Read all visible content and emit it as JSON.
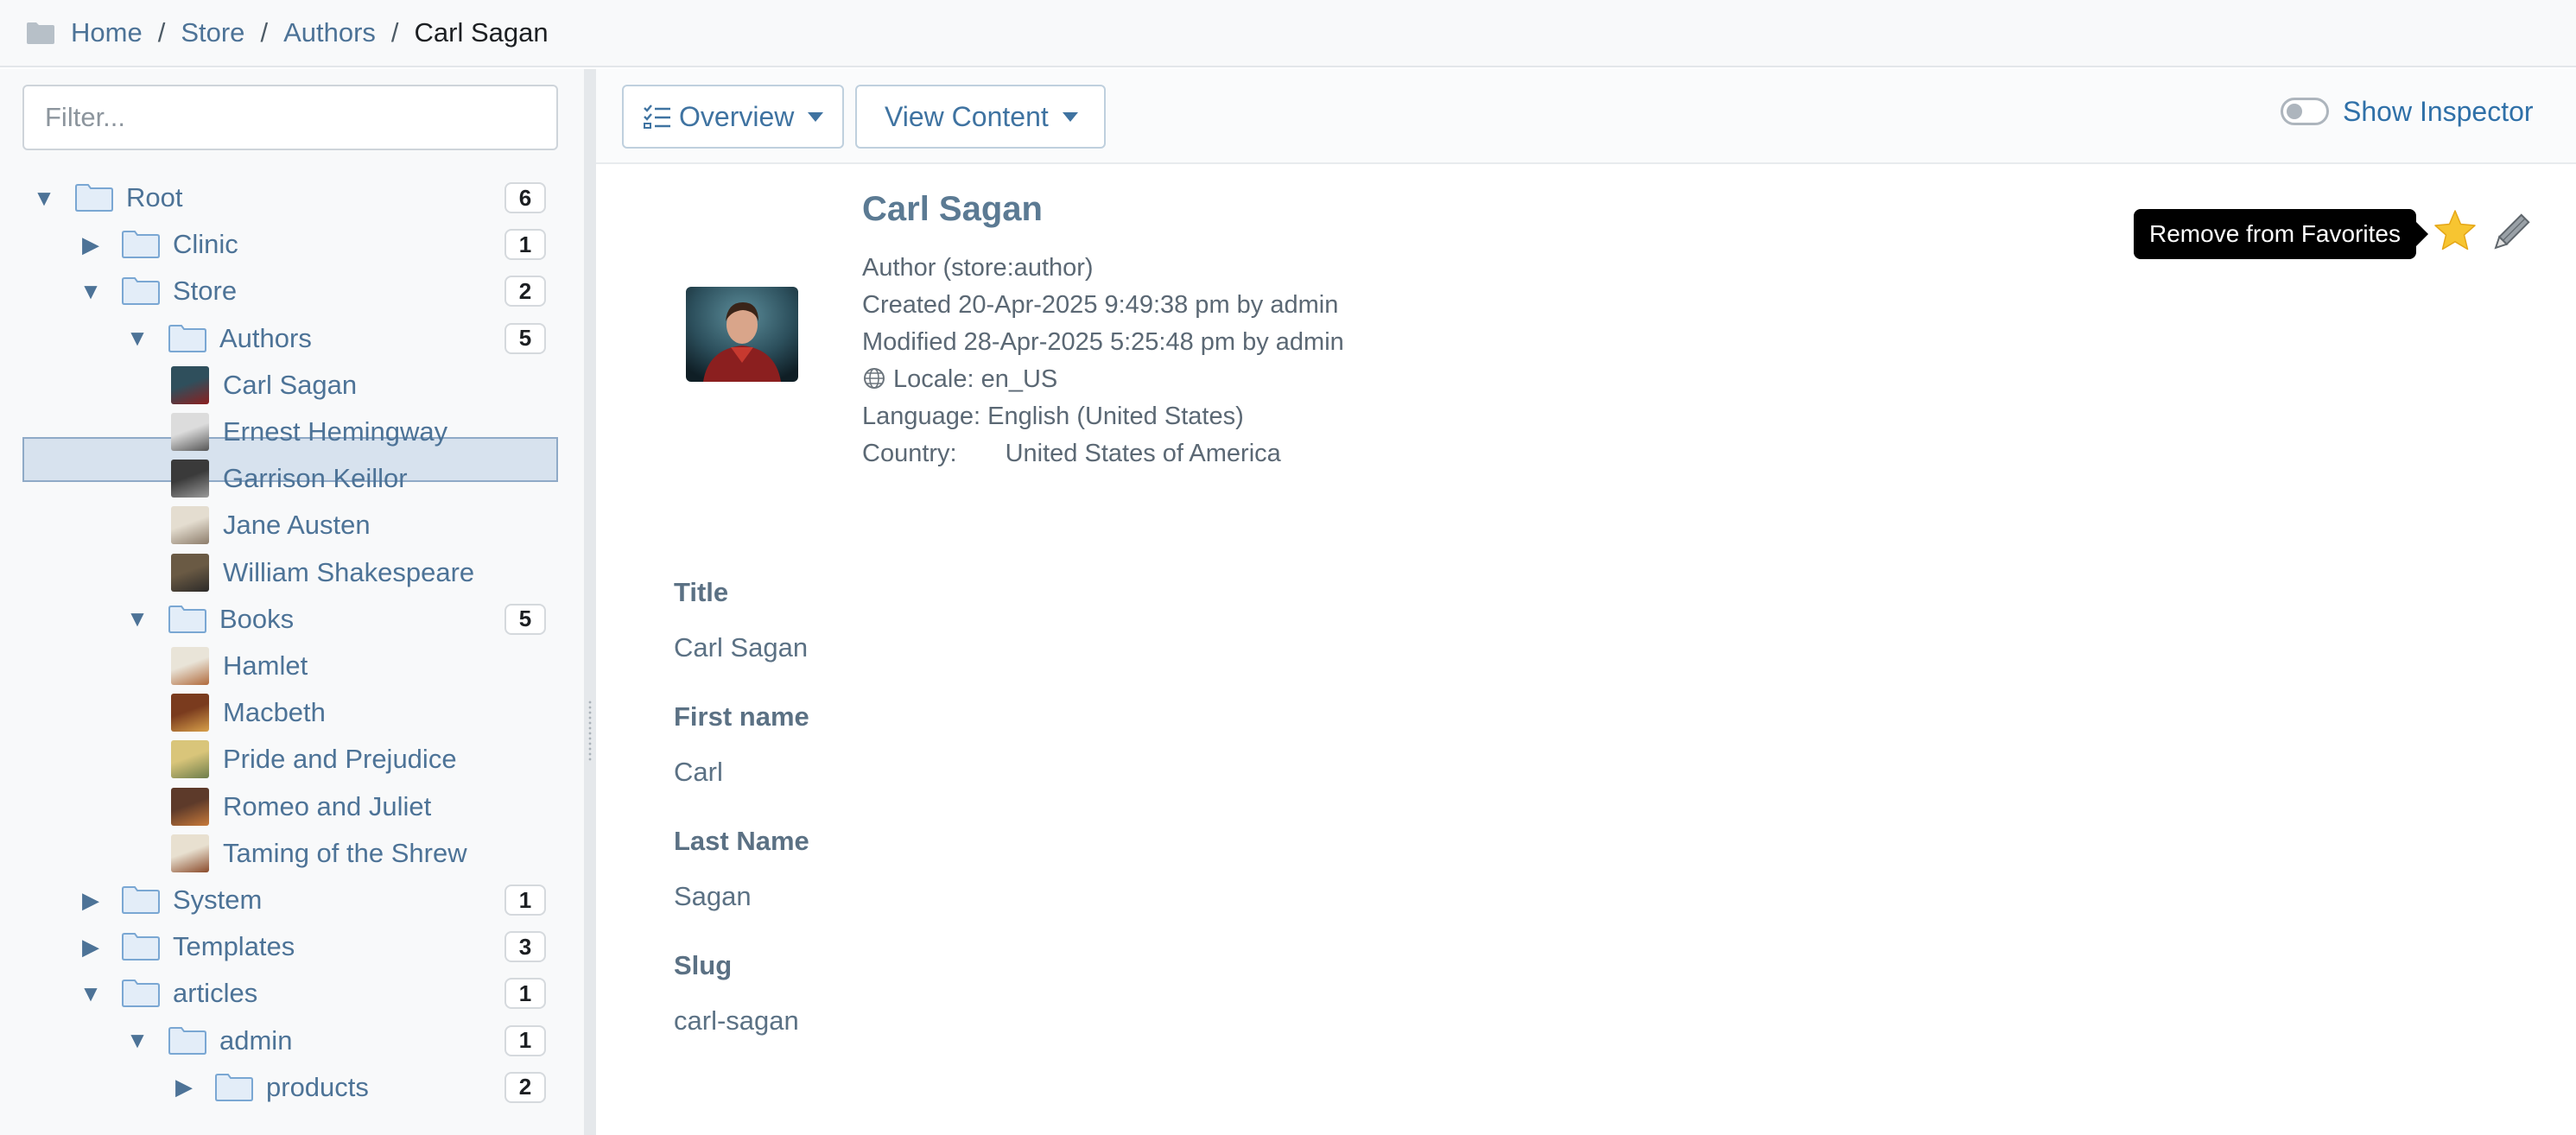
{
  "breadcrumb": {
    "items": [
      "Home",
      "Store",
      "Authors"
    ],
    "separator": "/",
    "current": "Carl Sagan"
  },
  "sidebar": {
    "filter_placeholder": "Filter...",
    "tree": [
      {
        "label": "Root",
        "count": "6",
        "expanded": true,
        "kind": "folder"
      },
      {
        "label": "Clinic",
        "count": "1",
        "expanded": false,
        "kind": "folder"
      },
      {
        "label": "Store",
        "count": "2",
        "expanded": true,
        "kind": "folder"
      },
      {
        "label": "Authors",
        "count": "5",
        "expanded": true,
        "kind": "folder"
      },
      {
        "label": "Carl Sagan",
        "kind": "item",
        "selected": true
      },
      {
        "label": "Ernest Hemingway",
        "kind": "item"
      },
      {
        "label": "Garrison Keillor",
        "kind": "item"
      },
      {
        "label": "Jane Austen",
        "kind": "item"
      },
      {
        "label": "William Shakespeare",
        "kind": "item"
      },
      {
        "label": "Books",
        "count": "5",
        "expanded": true,
        "kind": "folder"
      },
      {
        "label": "Hamlet",
        "kind": "item"
      },
      {
        "label": "Macbeth",
        "kind": "item"
      },
      {
        "label": "Pride and Prejudice",
        "kind": "item"
      },
      {
        "label": "Romeo and Juliet",
        "kind": "item"
      },
      {
        "label": "Taming of the Shrew",
        "kind": "item"
      },
      {
        "label": "System",
        "count": "1",
        "expanded": false,
        "kind": "folder"
      },
      {
        "label": "Templates",
        "count": "3",
        "expanded": false,
        "kind": "folder"
      },
      {
        "label": "articles",
        "count": "1",
        "expanded": true,
        "kind": "folder"
      },
      {
        "label": "admin",
        "count": "1",
        "expanded": true,
        "kind": "folder"
      },
      {
        "label": "products",
        "count": "2",
        "expanded": false,
        "kind": "folder"
      }
    ]
  },
  "toolbar": {
    "overview_label": "Overview",
    "view_content_label": "View Content",
    "inspector_label": "Show Inspector",
    "inspector_on": false
  },
  "content": {
    "title": "Carl Sagan",
    "type_line": "Author (store:author)",
    "created": "Created 20-Apr-2025 9:49:38 pm by admin",
    "modified": "Modified 28-Apr-2025 5:25:48 pm by admin",
    "locale": "Locale: en_US",
    "language": "Language: English (United States)",
    "country_label": "Country:",
    "country_value": "United States of America",
    "tooltip": "Remove from Favorites",
    "fields": [
      {
        "label": "Title",
        "value": "Carl Sagan"
      },
      {
        "label": "First name",
        "value": "Carl"
      },
      {
        "label": "Last Name",
        "value": "Sagan"
      },
      {
        "label": "Slug",
        "value": "carl-sagan"
      }
    ]
  },
  "colors": {
    "link": "#4d7397",
    "favorite_star": "#f7c531",
    "selection": "#d7e2ee"
  },
  "icons": [
    "folder-icon",
    "caret-down-icon",
    "caret-right-icon",
    "checklist-icon",
    "globe-icon",
    "star-icon",
    "pencil-icon"
  ]
}
